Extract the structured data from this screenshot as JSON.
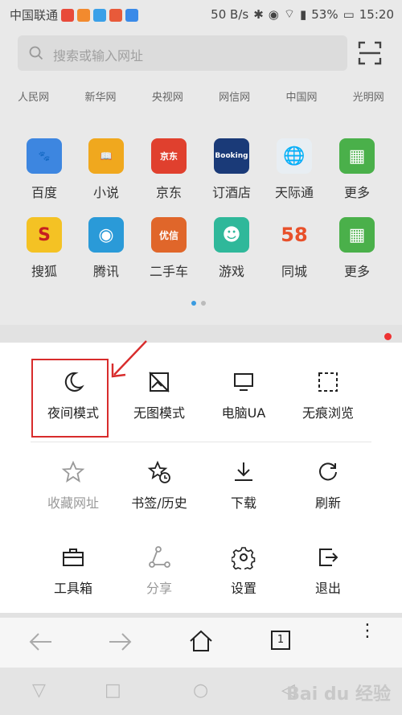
{
  "status": {
    "carrier": "中国联通",
    "speed": "50 B/s",
    "battery": "53%",
    "time": "15:20"
  },
  "search": {
    "placeholder": "搜索或输入网址"
  },
  "sites": [
    "人民网",
    "新华网",
    "央视网",
    "网信网",
    "中国网",
    "光明网"
  ],
  "apps_row1": [
    {
      "label": "百度",
      "color": "#3d86e0",
      "glyph": "🐾"
    },
    {
      "label": "小说",
      "color": "#f0a81e",
      "glyph": "📖"
    },
    {
      "label": "京东",
      "color": "#e0402e",
      "glyph": "京东"
    },
    {
      "label": "订酒店",
      "color": "#1a3a78",
      "glyph": "Booking"
    },
    {
      "label": "天际通",
      "color": "#e8eef3",
      "glyph": "🌐"
    },
    {
      "label": "更多",
      "color": "#4ab04a",
      "glyph": "▦"
    }
  ],
  "apps_row2": [
    {
      "label": "搜狐",
      "color": "#f4c224",
      "glyph": "S"
    },
    {
      "label": "腾讯",
      "color": "#2a9ad8",
      "glyph": "◉"
    },
    {
      "label": "二手车",
      "color": "#e0662a",
      "glyph": "优信"
    },
    {
      "label": "游戏",
      "color": "#2fb89a",
      "glyph": "☻"
    },
    {
      "label": "同城",
      "color": "#ffffff",
      "glyph": "58"
    },
    {
      "label": "更多",
      "color": "#4ab04a",
      "glyph": "▦"
    }
  ],
  "menu": {
    "night_mode": "夜间模式",
    "no_image": "无图模式",
    "pc_ua": "电脑UA",
    "incognito": "无痕浏览",
    "favorite": "收藏网址",
    "bookmarks": "书签/历史",
    "download": "下载",
    "refresh": "刷新",
    "toolbox": "工具箱",
    "share": "分享",
    "settings": "设置",
    "exit": "退出"
  },
  "nav": {
    "tab_count": "1"
  },
  "watermark": "Bai du 经验"
}
